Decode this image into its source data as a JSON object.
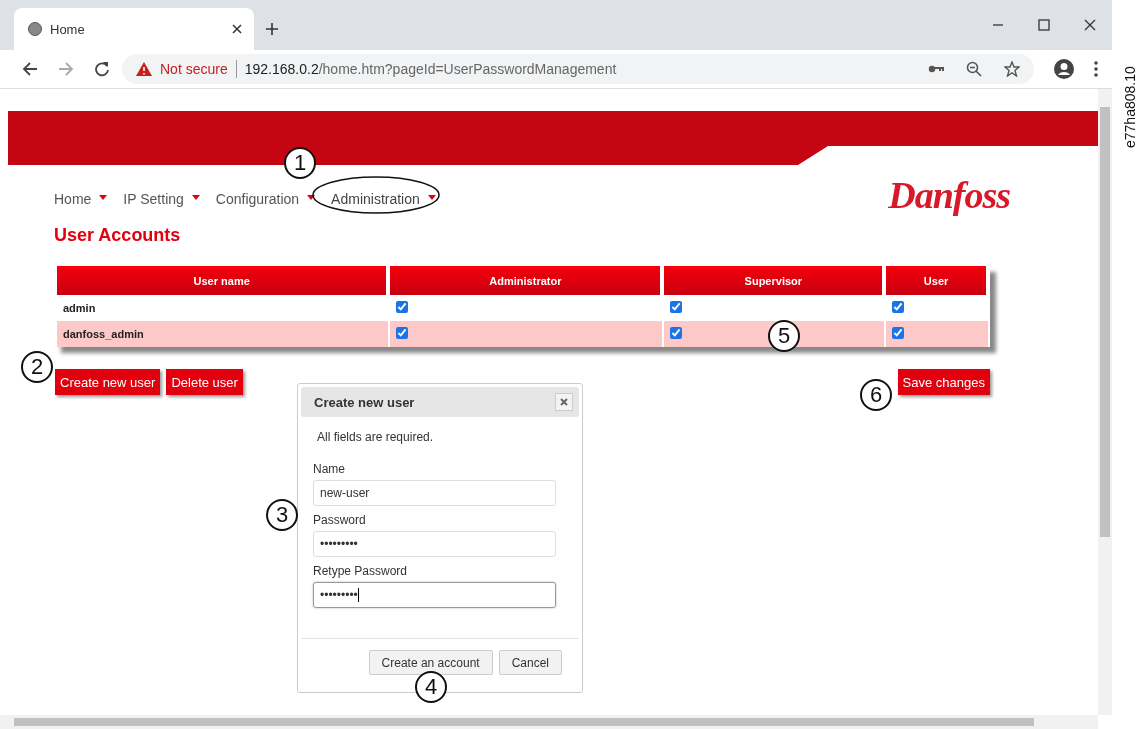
{
  "browser": {
    "tab_title": "Home",
    "security_label": "Not secure",
    "url_host": "192.168.0.2",
    "url_path": "/home.htm?pageId=UserPasswordManagement"
  },
  "nav": [
    {
      "label": "Home",
      "highlighted": false
    },
    {
      "label": "IP Setting",
      "highlighted": false
    },
    {
      "label": "Configuration",
      "highlighted": false
    },
    {
      "label": "Administration",
      "highlighted": true
    }
  ],
  "logo": "Danfoss",
  "page_title": "User Accounts",
  "table": {
    "columns": [
      "User name",
      "Administrator",
      "Supervisor",
      "User"
    ],
    "rows": [
      {
        "name": "admin",
        "checks": [
          {
            "checked": true
          },
          {
            "checked": true
          },
          {
            "checked": true
          }
        ]
      },
      {
        "name": "danfoss_admin",
        "checks": [
          {
            "checked": true
          },
          {
            "checked": true
          },
          {
            "checked": true
          }
        ]
      }
    ]
  },
  "buttons": [
    "Create new user",
    "Delete user"
  ],
  "save_button": "Save changes",
  "dialog": {
    "title": "Create new user",
    "note": "All fields are required.",
    "fields": [
      {
        "label": "Name",
        "value": "new-user",
        "focused": false
      },
      {
        "label": "Password",
        "value": "•••••••••",
        "focused": false
      },
      {
        "label": "Retype Password",
        "value": "•••••••••",
        "focused": true
      }
    ],
    "buttons": [
      "Create an account",
      "Cancel"
    ]
  },
  "callouts": [
    "1",
    "2",
    "3",
    "4",
    "5",
    "6"
  ],
  "figure_id": "e77ha808.10"
}
